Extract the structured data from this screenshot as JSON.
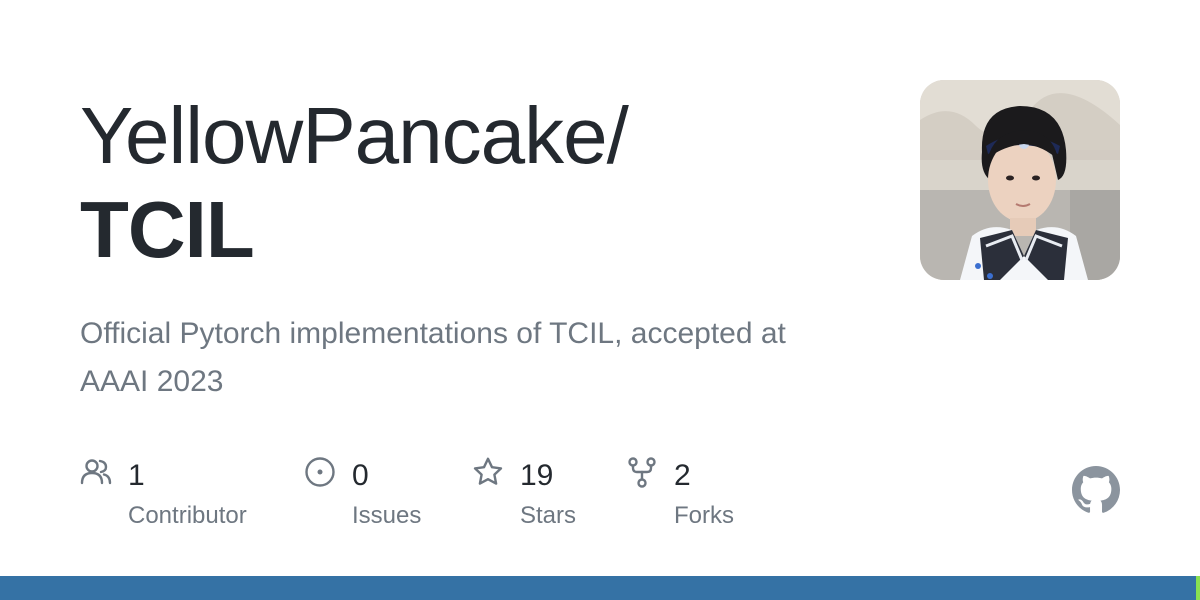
{
  "repo": {
    "owner": "YellowPancake/",
    "name": "TCIL",
    "description": "Official Pytorch implementations of TCIL, accepted at AAAI 2023"
  },
  "avatar": {
    "icon": "user-avatar-photo"
  },
  "stats": [
    {
      "icon": "people-icon",
      "count": "1",
      "label": "Contributor"
    },
    {
      "icon": "issue-opened-icon",
      "count": "0",
      "label": "Issues"
    },
    {
      "icon": "star-icon",
      "count": "19",
      "label": "Stars"
    },
    {
      "icon": "repo-forked-icon",
      "count": "2",
      "label": "Forks"
    }
  ],
  "colors": {
    "text_primary": "#24292f",
    "text_secondary": "#6e7781",
    "icon_muted": "#8b949e",
    "language_bar": "#3572a5",
    "language_bar_accent": "#89e051"
  }
}
